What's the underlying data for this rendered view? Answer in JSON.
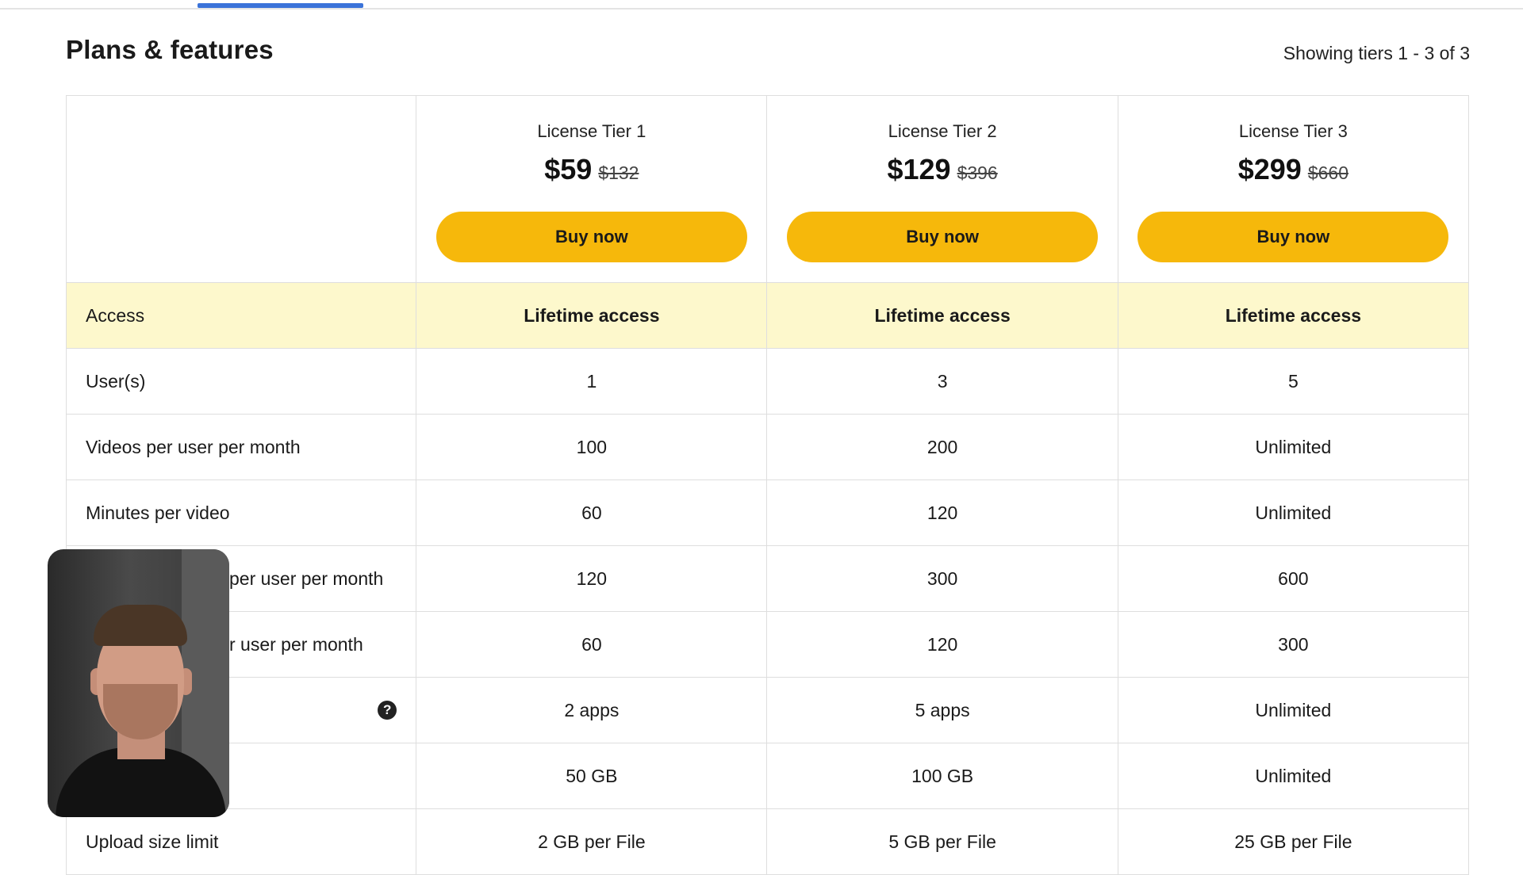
{
  "header": {
    "title": "Plans & features",
    "tier_count": "Showing tiers 1 - 3 of 3"
  },
  "tiers": [
    {
      "name": "License Tier 1",
      "price": "$59",
      "original_price": "$132",
      "cta": "Buy now"
    },
    {
      "name": "License Tier 2",
      "price": "$129",
      "original_price": "$396",
      "cta": "Buy now"
    },
    {
      "name": "License Tier 3",
      "price": "$299",
      "original_price": "$660",
      "cta": "Buy now"
    }
  ],
  "rows": [
    {
      "label": "Access",
      "values": [
        "Lifetime access",
        "Lifetime access",
        "Lifetime access"
      ]
    },
    {
      "label": "User(s)",
      "values": [
        "1",
        "3",
        "5"
      ]
    },
    {
      "label": "Videos per user per month",
      "values": [
        "100",
        "200",
        "Unlimited"
      ]
    },
    {
      "label": "Minutes per video",
      "values": [
        "60",
        "120",
        "Unlimited"
      ]
    },
    {
      "label": "per user per month",
      "values": [
        "120",
        "300",
        "600"
      ]
    },
    {
      "label": "r user per month",
      "values": [
        "60",
        "120",
        "300"
      ]
    },
    {
      "label": "",
      "values": [
        "2 apps",
        "5 apps",
        "Unlimited"
      ]
    },
    {
      "label": "",
      "values": [
        "50 GB",
        "100 GB",
        "Unlimited"
      ]
    },
    {
      "label": "Upload size limit",
      "values": [
        "2 GB per File",
        "5 GB per File",
        "25 GB per File"
      ]
    }
  ],
  "icons": {
    "help": "help-circle-icon"
  },
  "colors": {
    "cta": "#f6b80b",
    "highlight_row": "#fdf8cc",
    "tab_indicator": "#3b73d9"
  }
}
